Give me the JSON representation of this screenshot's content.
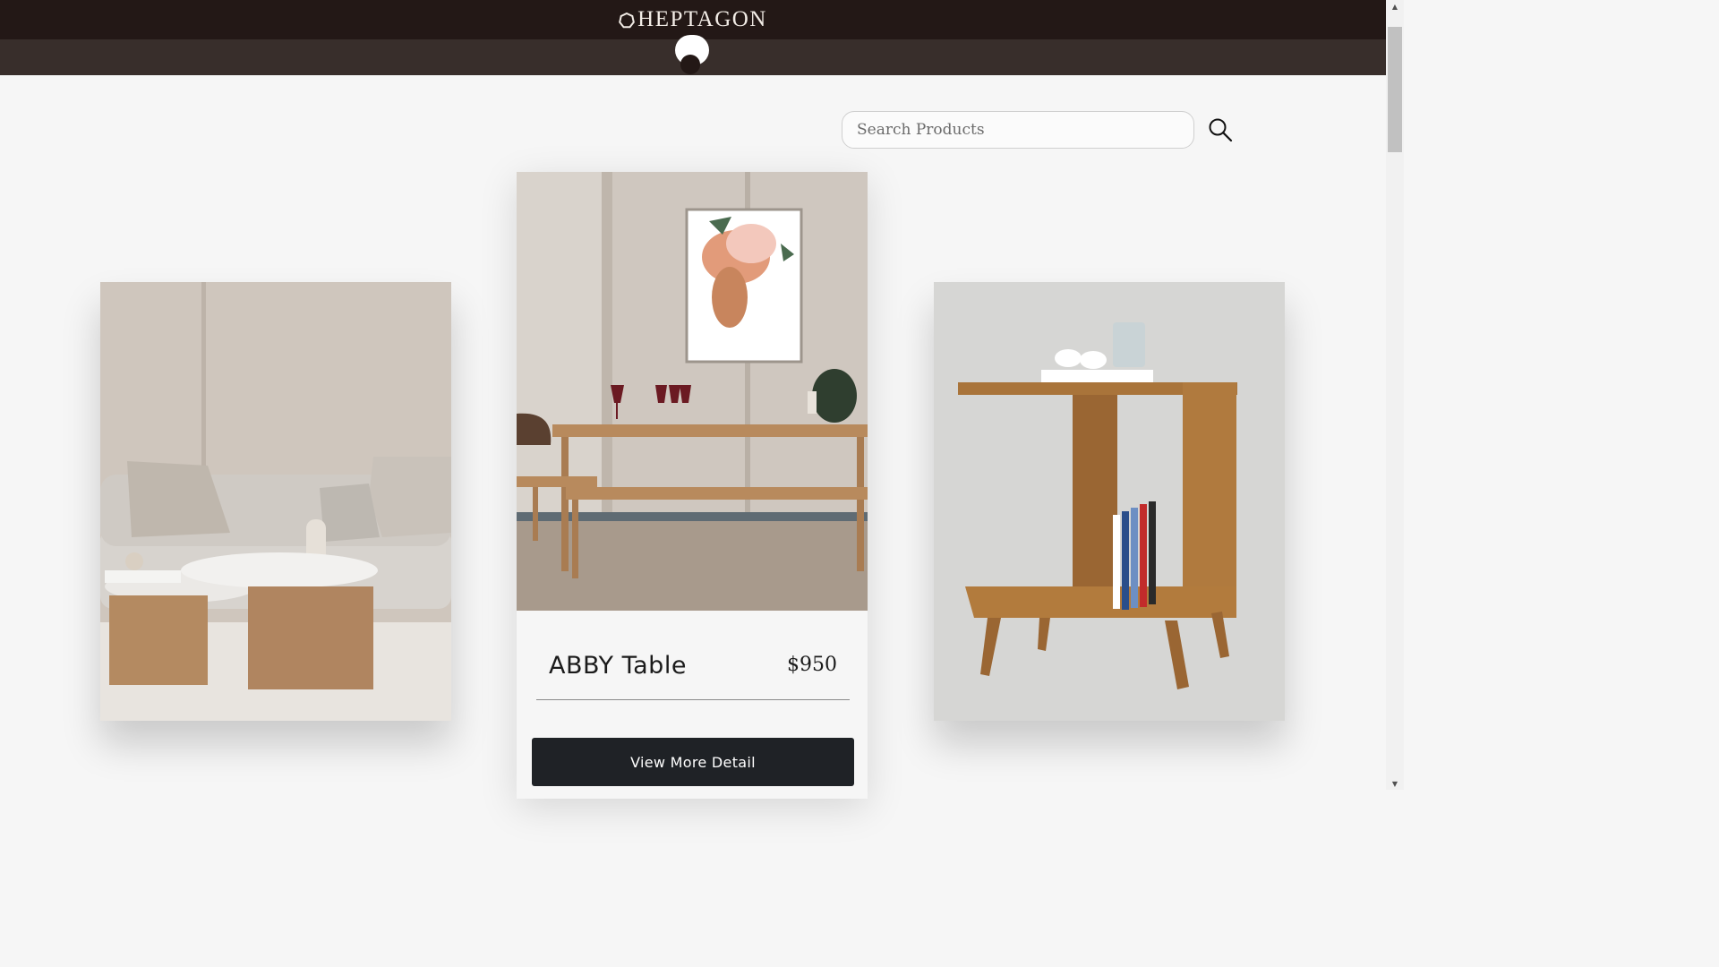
{
  "header": {
    "brand": "HEPTAGON",
    "brand_icon": "heptagon-icon"
  },
  "theme_toggle": {
    "icon": "theme-toggle"
  },
  "search": {
    "placeholder": "Search Products",
    "value": "",
    "icon": "search-icon"
  },
  "carousel": {
    "items": [
      {
        "scene": "living-room-sofa-coffee-tables",
        "image_label": "sofa with round coffee tables"
      },
      {
        "scene": "dining-table-bench",
        "name": "ABBY Table",
        "price": "$950",
        "button_label": "View More Detail"
      },
      {
        "scene": "wooden-side-table",
        "image_label": "wooden side table with books"
      }
    ]
  },
  "colors": {
    "topbar": "#231816",
    "subbar": "#382e2b",
    "button": "#1f2226",
    "background": "#f6f6f6"
  }
}
